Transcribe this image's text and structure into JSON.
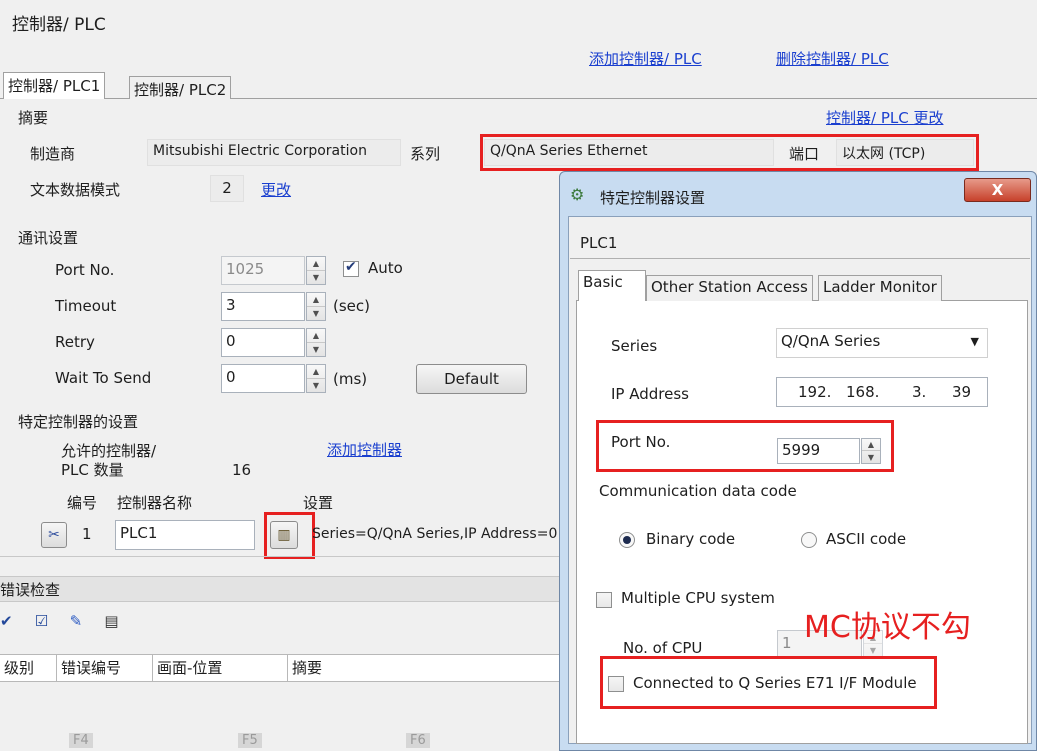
{
  "main": {
    "title": "控制器/ PLC",
    "add_link": "添加控制器/ PLC",
    "delete_link": "删除控制器/ PLC",
    "tabs": [
      "控制器/ PLC1",
      "控制器/ PLC2"
    ],
    "summary_label": "摘要",
    "change_link": "控制器/ PLC 更改",
    "maker_label": "制造商",
    "maker_value": "Mitsubishi Electric Corporation",
    "series_label": "系列",
    "series_value": "Q/QnA Series Ethernet",
    "port_label": "端口",
    "port_value": "以太网 (TCP)",
    "text_mode_label": "文本数据模式",
    "text_mode_value": "2",
    "text_mode_change": "更改",
    "comm_title": "通讯设置",
    "port_no_label": "Port No.",
    "port_no_value": "1025",
    "auto_label": "Auto",
    "timeout_label": "Timeout",
    "timeout_value": "3",
    "timeout_unit": "(sec)",
    "retry_label": "Retry",
    "retry_value": "0",
    "wait_label": "Wait To Send",
    "wait_value": "0",
    "wait_unit": "(ms)",
    "default_btn": "Default",
    "specific_title": "特定控制器的设置",
    "allowed_label_1": "允许的控制器/",
    "allowed_label_2": "PLC 数量",
    "allowed_value": "16",
    "add_controller_link": "添加控制器",
    "col_no": "编号",
    "col_name": "控制器名称",
    "col_setting": "设置",
    "row_no": "1",
    "row_name": "PLC1",
    "row_setting": "Series=Q/QnA Series,IP Address=0"
  },
  "error_panel": {
    "title": "错误检查",
    "columns": [
      "级别",
      "错误编号",
      "画面-位置",
      "摘要"
    ],
    "bottom_labels": [
      "F4",
      "F5",
      "F6"
    ]
  },
  "dialog": {
    "title": "特定控制器设置",
    "close": "X",
    "plc_name": "PLC1",
    "tabs": [
      "Basic",
      "Other Station Access",
      "Ladder Monitor"
    ],
    "series_label": "Series",
    "series_value": "Q/QnA Series",
    "ip_label": "IP Address",
    "ip_parts": [
      "192.",
      "168.",
      "3.",
      "39"
    ],
    "port_label": "Port No.",
    "port_value": "5999",
    "comm_code_label": "Communication data code",
    "binary_label": "Binary code",
    "ascii_label": "ASCII code",
    "multi_cpu_label": "Multiple CPU system",
    "no_cpu_label": "No. of CPU",
    "no_cpu_value": "1",
    "e71_label": "Connected to Q Series E71 I/F Module"
  },
  "annotation": {
    "text": "MC协议不勾",
    "color": "#e62020"
  }
}
